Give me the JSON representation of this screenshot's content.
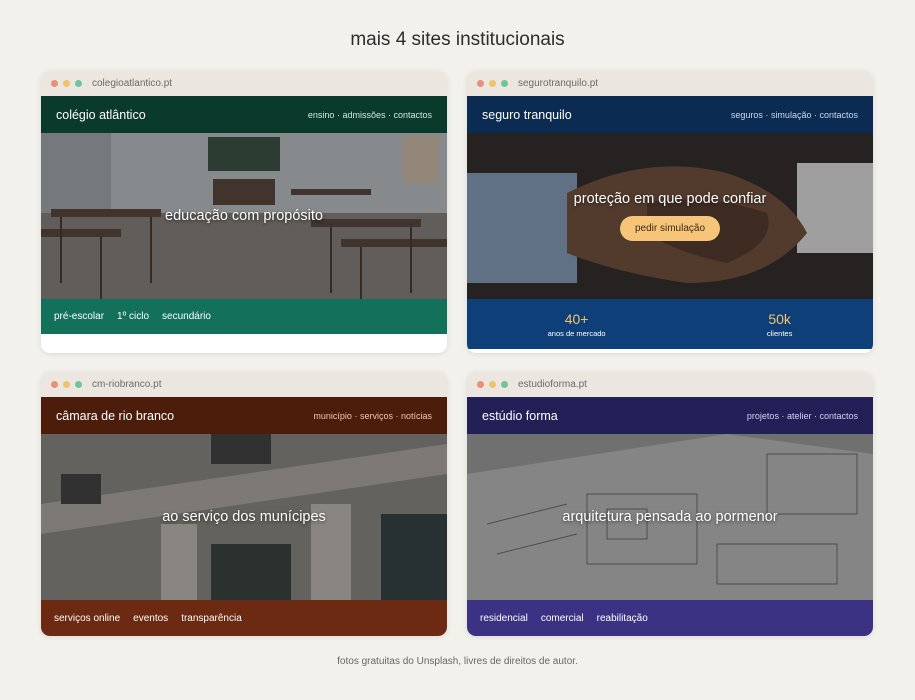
{
  "title": "mais 4 sites institucionais",
  "credit": "fotos gratuitas do Unsplash, livres de direitos de autor.",
  "colors": {
    "page_bg": "#f3f1ec",
    "green_head": "#0a3a2c",
    "green_foot": "#13705a",
    "navy_head": "#0c2b52",
    "navy_stats": "#0f3f79",
    "brown_head": "#4d1d0c",
    "brown_foot": "#6b2a11",
    "purple_head": "#232058",
    "purple_foot": "#3c3283",
    "gold": "#f3c36d"
  },
  "cards": [
    {
      "url": "colegioatlantico.pt",
      "name": "colégio atlântico",
      "nav": [
        "ensino",
        "admissões",
        "contactos"
      ],
      "hero": "educação com propósito",
      "footer": [
        "pré-escolar",
        "1º ciclo",
        "secundário"
      ]
    },
    {
      "url": "segurotranquilo.pt",
      "name": "seguro tranquilo",
      "nav": [
        "seguros",
        "simulação",
        "contactos"
      ],
      "hero": "proteção em que pode confiar",
      "button": "pedir simulação",
      "stats": [
        {
          "value": "40+",
          "label": "anos de mercado"
        },
        {
          "value": "50k",
          "label": "clientes"
        }
      ]
    },
    {
      "url": "cm-riobranco.pt",
      "name": "câmara de rio branco",
      "nav": [
        "município",
        "serviços",
        "notícias"
      ],
      "hero": "ao serviço dos munícipes",
      "footer": [
        "serviços online",
        "eventos",
        "transparência"
      ]
    },
    {
      "url": "estudioforma.pt",
      "name": "estúdio forma",
      "nav": [
        "projetos",
        "atelier",
        "contactos"
      ],
      "hero": "arquitetura pensada ao pormenor",
      "footer": [
        "residencial",
        "comercial",
        "reabilitação"
      ]
    }
  ]
}
